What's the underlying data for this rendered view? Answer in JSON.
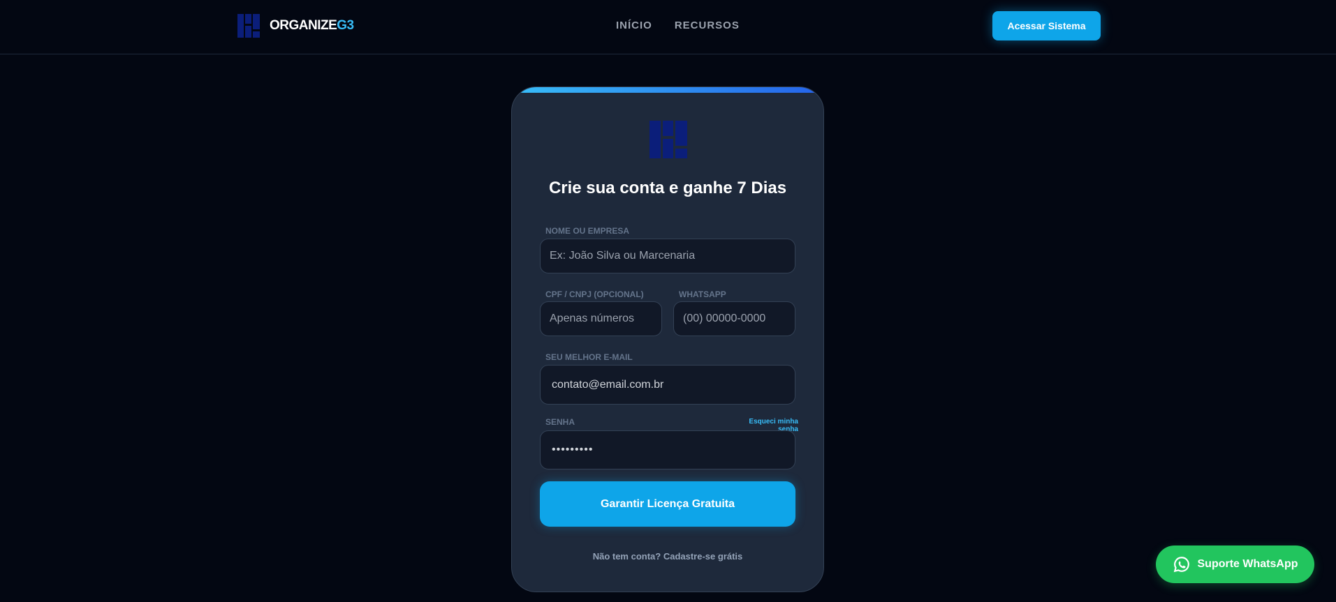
{
  "header": {
    "brand_main": "ORGANIZE",
    "brand_accent": "G3",
    "logo_icon": "blocks-logo-icon",
    "nav": [
      {
        "label": "INÍCIO"
      },
      {
        "label": "RECURSOS"
      }
    ],
    "access_button": "Acessar Sistema"
  },
  "form": {
    "logo_icon": "blocks-logo-icon",
    "title": "Crie sua conta e ganhe 7 Dias",
    "name": {
      "label": "NOME OU EMPRESA",
      "placeholder": "Ex: João Silva ou Marcenaria"
    },
    "document": {
      "label": "CPF / CNPJ (OPCIONAL)",
      "placeholder": "Apenas números"
    },
    "whatsapp": {
      "label": "WHATSAPP",
      "placeholder": "(00) 00000-0000"
    },
    "email": {
      "label": "SEU MELHOR E-MAIL",
      "value": "contato@email.com.br"
    },
    "password": {
      "label": "SENHA",
      "value": "•••••••••",
      "forgot_link": "Esqueci minha senha"
    },
    "submit": "Garantir Licença Gratuita",
    "signup_link": "Não tem conta? Cadastre-se grátis"
  },
  "support": {
    "label": "Suporte WhatsApp",
    "icon": "whatsapp-icon"
  },
  "colors": {
    "background": "#030712",
    "card": "#1e293b",
    "accent": "#0ea5e9",
    "logo": "#0b1e7a",
    "whatsapp": "#22c55e"
  }
}
